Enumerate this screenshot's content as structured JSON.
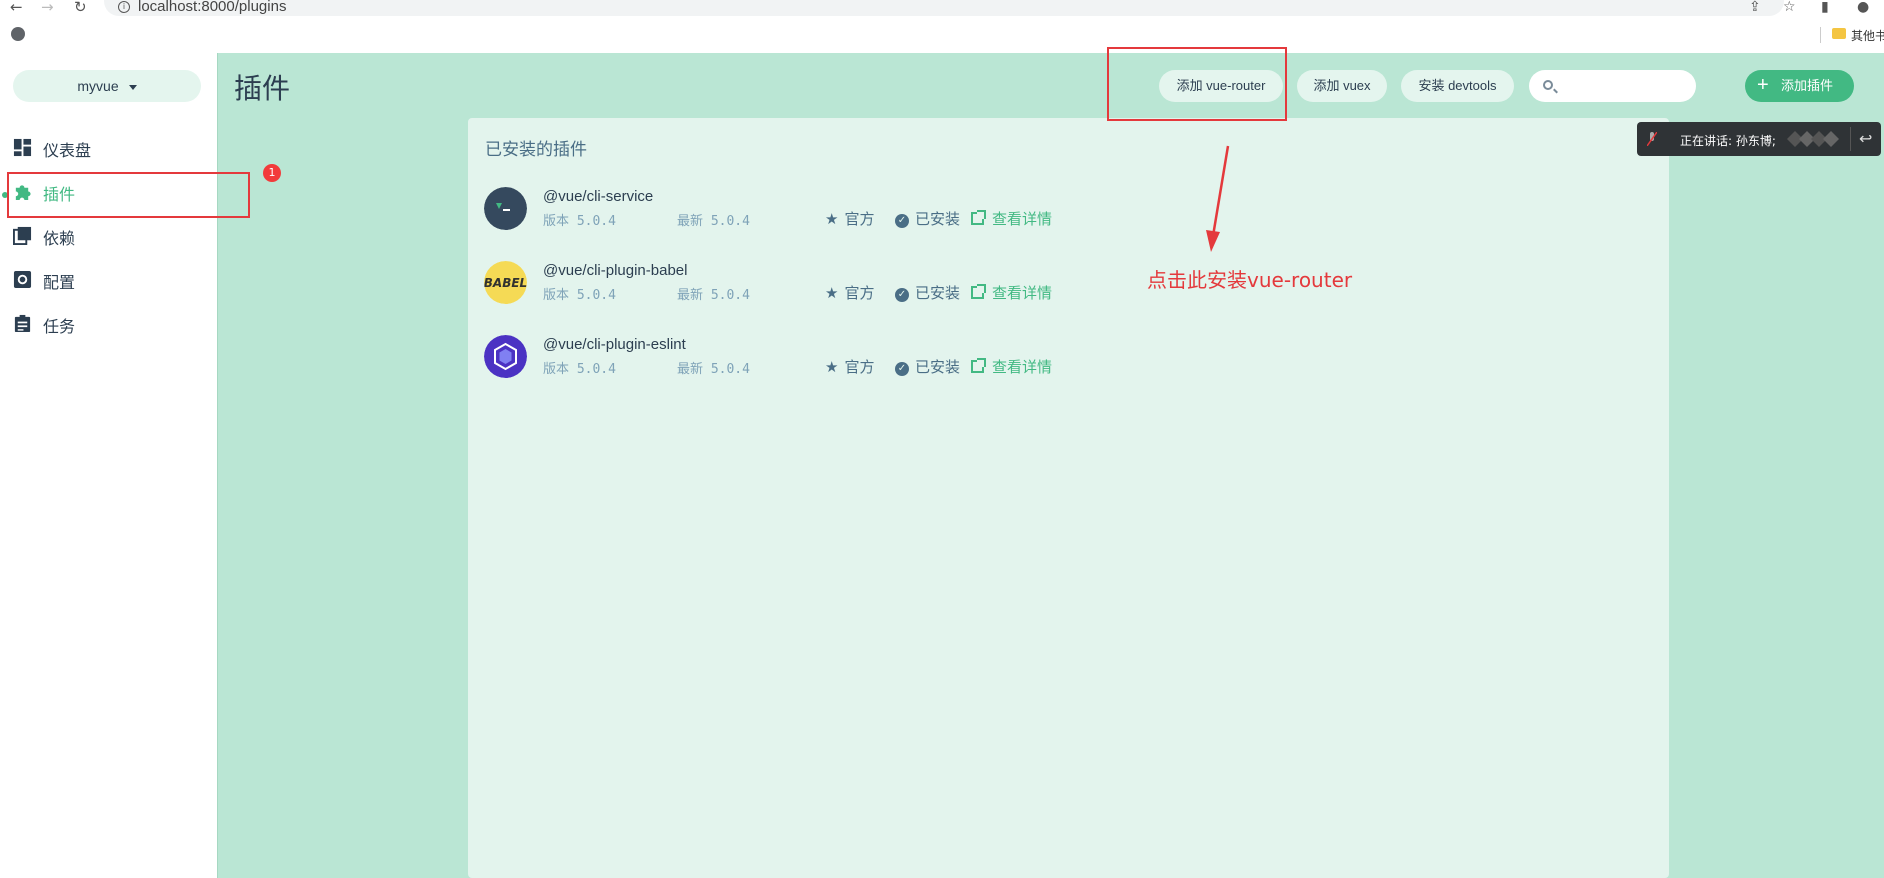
{
  "browser": {
    "url": "localhost:8000/plugins",
    "bookmark_label": "其他书"
  },
  "sidebar": {
    "project": "myvue",
    "items": [
      {
        "label": "仪表盘",
        "icon": "dashboard-icon"
      },
      {
        "label": "插件",
        "icon": "puzzle-icon",
        "active": true
      },
      {
        "label": "依赖",
        "icon": "library-icon"
      },
      {
        "label": "配置",
        "icon": "settings-icon"
      },
      {
        "label": "任务",
        "icon": "assignment-icon"
      }
    ]
  },
  "header": {
    "title": "插件",
    "buttons": [
      "添加 vue-router",
      "添加 vuex",
      "安装 devtools"
    ],
    "search_placeholder": "",
    "add_plugin": "添加插件"
  },
  "panel": {
    "title": "已安装的插件",
    "plugins": [
      {
        "name": "@vue/cli-service",
        "version": "版本 5.0.4",
        "latest": "最新 5.0.4",
        "official": "官方",
        "installed": "已安装",
        "details": "查看详情",
        "logo": "vue-cli-logo"
      },
      {
        "name": "@vue/cli-plugin-babel",
        "version": "版本 5.0.4",
        "latest": "最新 5.0.4",
        "official": "官方",
        "installed": "已安装",
        "details": "查看详情",
        "logo": "babel-logo",
        "logo_text": "BABEL"
      },
      {
        "name": "@vue/cli-plugin-eslint",
        "version": "版本 5.0.4",
        "latest": "最新 5.0.4",
        "official": "官方",
        "installed": "已安装",
        "details": "查看详情",
        "logo": "eslint-logo"
      }
    ]
  },
  "annotations": {
    "badge": "1",
    "instruction": "点击此安装vue-router"
  },
  "meeting": {
    "speaking": "正在讲话: 孙东博;"
  },
  "colors": {
    "accent": "#42b983",
    "main_bg": "#bae6d4",
    "panel_bg": "#e3f4ed",
    "annotation_red": "#e4393c"
  }
}
